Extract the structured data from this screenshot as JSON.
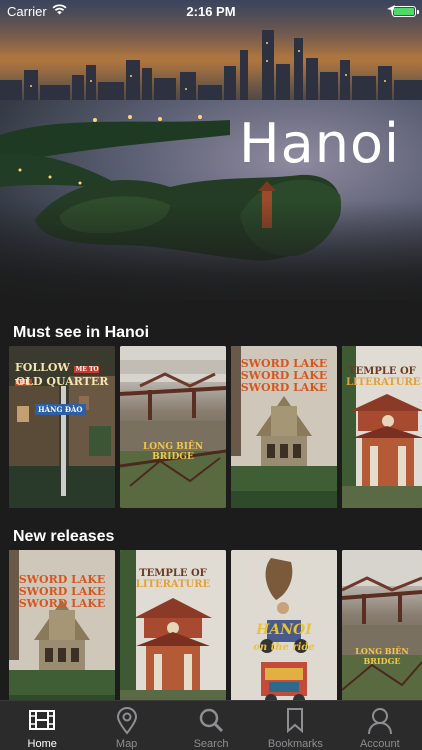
{
  "status_bar": {
    "carrier": "Carrier",
    "time": "2:16 PM"
  },
  "hero": {
    "city": "Hanoi"
  },
  "sections": {
    "must_see": {
      "title": "Must see in Hanoi",
      "cards": [
        {
          "line1": "FOLLOW",
          "line1b": "ME TO THE",
          "line2": "OLD QUARTER",
          "sign": "HÀNG ĐÀO"
        },
        {
          "caption": "LONG BIÊN BRIDGE"
        },
        {
          "line1": "SWORD LAKE",
          "line2": "SWORD LAKE",
          "line3": "SWORD LAKE"
        },
        {
          "line1": "TEMPLE OF",
          "line2": "LITERATURE"
        }
      ]
    },
    "new_releases": {
      "title": "New releases",
      "cards": [
        {
          "line1": "SWORD LAKE",
          "line2": "SWORD LAKE",
          "line3": "SWORD LAKE"
        },
        {
          "line1": "TEMPLE OF",
          "line2": "LITERATURE"
        },
        {
          "title": "HANOI",
          "subtitle": "on the ride"
        },
        {
          "caption": "LONG BIÊN BRIDGE"
        }
      ]
    }
  },
  "tabbar": {
    "tabs": [
      {
        "label": "Home",
        "icon": "film-icon",
        "active": true
      },
      {
        "label": "Map",
        "icon": "map-pin-icon",
        "active": false
      },
      {
        "label": "Search",
        "icon": "search-icon",
        "active": false
      },
      {
        "label": "Bookmarks",
        "icon": "bookmark-icon",
        "active": false
      },
      {
        "label": "Account",
        "icon": "person-icon",
        "active": false
      }
    ]
  },
  "colors": {
    "background": "#1c1c1c",
    "tabbar": "#2b2b2b",
    "tab_inactive": "#8e8e93",
    "battery": "#4cd964"
  }
}
